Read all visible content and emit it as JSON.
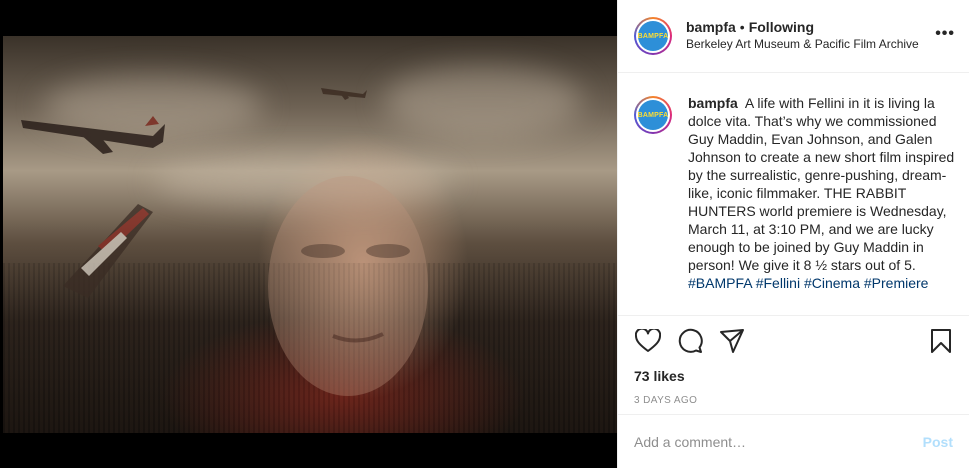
{
  "media": {
    "icons": [
      "airplane-icon",
      "airplane-icon",
      "airplane-tail-icon"
    ]
  },
  "header": {
    "avatar_text": "BAMPFA",
    "username": "bampfa",
    "separator": "•",
    "follow_status": "Following",
    "subtitle": "Berkeley Art Museum & Pacific Film Archive",
    "more_label": "•••"
  },
  "caption": {
    "avatar_text": "BAMPFA",
    "username": "bampfa",
    "text": "A life with Fellini in it is living la dolce vita. That’s why we commissioned Guy Maddin, Evan Johnson, and Galen Johnson to create a new short film inspired by the surrealistic, genre-pushing, dream-like, iconic filmmaker. THE RABBIT HUNTERS world premiere is Wednesday, March 11, at 3:10 PM, and we are lucky enough to be joined by Guy Maddin in person! We give it 8 ½ stars out of 5.",
    "hashtags": [
      "#BAMPFA",
      "#Fellini",
      "#Cinema",
      "#Premiere"
    ]
  },
  "actions": {
    "icons": [
      "heart-icon",
      "comment-icon",
      "share-icon",
      "bookmark-icon"
    ],
    "likes": "73 likes",
    "date": "3 DAYS AGO"
  },
  "add_comment": {
    "placeholder": "Add a comment…",
    "post_label": "Post"
  },
  "colors": {
    "text": "#262626",
    "muted": "#8e8e8e",
    "hashtag": "#00376b",
    "post_disabled": "#b2dffc",
    "border": "#efefef"
  }
}
